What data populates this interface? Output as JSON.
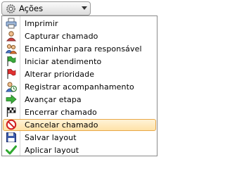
{
  "button": {
    "label": "Ações",
    "icon": "gear-icon"
  },
  "menu": {
    "items": [
      {
        "label": "Imprimir",
        "icon": "printer-icon"
      },
      {
        "label": "Capturar chamado",
        "icon": "user-capture-icon"
      },
      {
        "label": "Encaminhar para responsável",
        "icon": "users-forward-icon"
      },
      {
        "label": "Iniciar atendimento",
        "icon": "green-flag-icon"
      },
      {
        "label": "Alterar prioridade",
        "icon": "red-flag-icon"
      },
      {
        "label": "Registrar acompanhamento",
        "icon": "clock-user-icon"
      },
      {
        "label": "Avançar etapa",
        "icon": "green-arrow-icon"
      },
      {
        "label": "Encerrar chamado",
        "icon": "checkered-flag-icon"
      },
      {
        "label": "Cancelar chamado",
        "icon": "cancel-icon",
        "state": "highlighted"
      },
      {
        "label": "Salvar layout",
        "icon": "floppy-disk-icon"
      },
      {
        "label": "Aplicar layout",
        "icon": "green-check-icon"
      }
    ]
  },
  "colors": {
    "highlight_bg": "#ffe8b8",
    "highlight_border": "#e8a848",
    "menu_border": "#8a8a8a"
  }
}
